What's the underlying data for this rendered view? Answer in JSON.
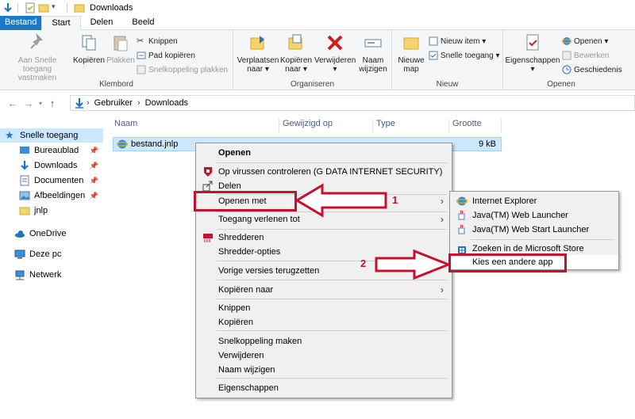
{
  "window": {
    "title": "Downloads"
  },
  "tabs": [
    "Bestand",
    "Start",
    "Delen",
    "Beeld"
  ],
  "ribbon": {
    "klembord": {
      "label": "Klembord",
      "pin_label_1": "Aan Snelle toegang",
      "pin_label_2": "vastmaken",
      "copy": "Kopiëren",
      "paste": "Plakken",
      "cut": "Knippen",
      "copy_path": "Pad kopiëren",
      "paste_shortcut": "Snelkoppeling plakken"
    },
    "organiseren": {
      "label": "Organiseren",
      "move_1": "Verplaatsen",
      "move_2": "naar ▾",
      "copyto_1": "Kopiëren",
      "copyto_2": "naar ▾",
      "delete_1": "Verwijderen",
      "delete_2": "▾",
      "rename_1": "Naam",
      "rename_2": "wijzigen"
    },
    "nieuw": {
      "label": "Nieuw",
      "new_folder_1": "Nieuwe",
      "new_folder_2": "map",
      "new_item": "Nieuw item ▾",
      "easy_access": "Snelle toegang ▾"
    },
    "openen": {
      "label": "Openen",
      "properties_1": "Eigenschappen",
      "properties_2": "▾",
      "open": "Openen ▾",
      "edit": "Bewerken",
      "history": "Geschiedenis"
    }
  },
  "address": {
    "crumbs": [
      "Gebruiker",
      "Downloads"
    ]
  },
  "navpane": {
    "items": [
      "Snelle toegang",
      "Bureaublad",
      "Downloads",
      "Documenten",
      "Afbeeldingen",
      "jnlp",
      "OneDrive",
      "Deze pc",
      "Netwerk"
    ]
  },
  "columns": [
    "Naam",
    "Gewijzigd op",
    "Type",
    "Grootte"
  ],
  "file": {
    "name": "bestand.jnlp",
    "size": "9 kB"
  },
  "context_menu": {
    "items": [
      "Openen",
      "Op virussen controleren (G DATA INTERNET SECURITY)",
      "Delen",
      "Openen met",
      "Toegang verlenen tot",
      "Shredderen",
      "Shredder-opties",
      "Vorige versies terugzetten",
      "Kopiëren naar",
      "Knippen",
      "Kopiëren",
      "Snelkoppeling maken",
      "Verwijderen",
      "Naam wijzigen",
      "Eigenschappen"
    ]
  },
  "submenu": {
    "items": [
      "Internet Explorer",
      "Java(TM) Web Launcher",
      "Java(TM) Web Start Launcher",
      "Zoeken in de Microsoft Store",
      "Kies een andere app"
    ]
  },
  "annotations": {
    "step1": "1",
    "step2": "2",
    "color": "#c8102e"
  }
}
